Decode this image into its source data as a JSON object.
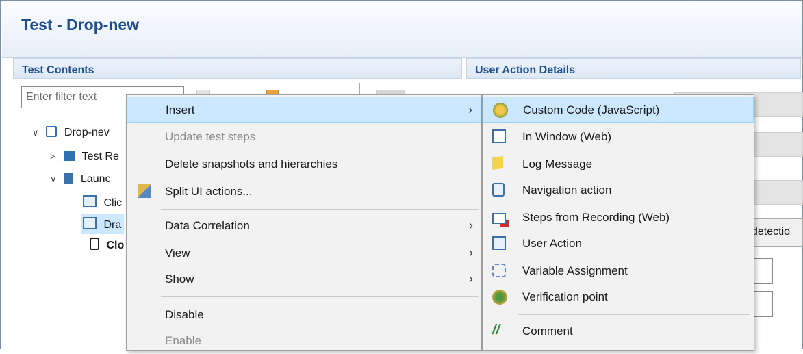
{
  "window": {
    "title": "Test - Drop-new"
  },
  "test_contents": {
    "header": "Test Contents",
    "filter_placeholder": "Enter filter text"
  },
  "user_action_details": {
    "header": "User Action Details",
    "partial_label": "detectio"
  },
  "tree": {
    "items": [
      {
        "label": "Drop-nev",
        "caret": "v",
        "icon": "test-icon"
      },
      {
        "label": "Test Re",
        "caret": ">",
        "icon": "table-icon"
      },
      {
        "label": "Launc",
        "caret": "v",
        "icon": "launch-icon"
      },
      {
        "label": "Clic",
        "icon": "user-action-icon"
      },
      {
        "label": "Dra",
        "icon": "user-action-icon"
      },
      {
        "label": "Clo",
        "icon": "device-icon"
      }
    ]
  },
  "context_menu": {
    "items": [
      {
        "label": "Insert",
        "submenu": true,
        "highlighted": true
      },
      {
        "label": "Update test steps",
        "disabled": true
      },
      {
        "label": "Delete snapshots and hierarchies"
      },
      {
        "label": "Split UI actions...",
        "icon": "split-icon"
      },
      {
        "label": "Data Correlation",
        "submenu": true
      },
      {
        "label": "View",
        "submenu": true
      },
      {
        "label": "Show",
        "submenu": true
      },
      {
        "label": "Disable"
      },
      {
        "label": "Enable",
        "disabled": true
      }
    ],
    "arrow": "›"
  },
  "insert_submenu": {
    "items": [
      {
        "label": "Custom Code (JavaScript)",
        "icon": "custom-code-icon",
        "highlighted": true
      },
      {
        "label": "In Window (Web)",
        "icon": "window-icon"
      },
      {
        "label": "Log Message",
        "icon": "log-message-icon"
      },
      {
        "label": "Navigation action",
        "icon": "navigation-icon"
      },
      {
        "label": "Steps from Recording (Web)",
        "icon": "recording-icon"
      },
      {
        "label": "User Action",
        "icon": "user-action-icon"
      },
      {
        "label": "Variable Assignment",
        "icon": "variable-icon"
      },
      {
        "label": "Verification point",
        "icon": "verification-icon"
      },
      {
        "label": "Comment",
        "icon": "comment-icon"
      }
    ]
  },
  "colors": {
    "highlight": "#cce8ff",
    "title": "#1f4e8c",
    "menu_bg": "#f2f2f2"
  }
}
